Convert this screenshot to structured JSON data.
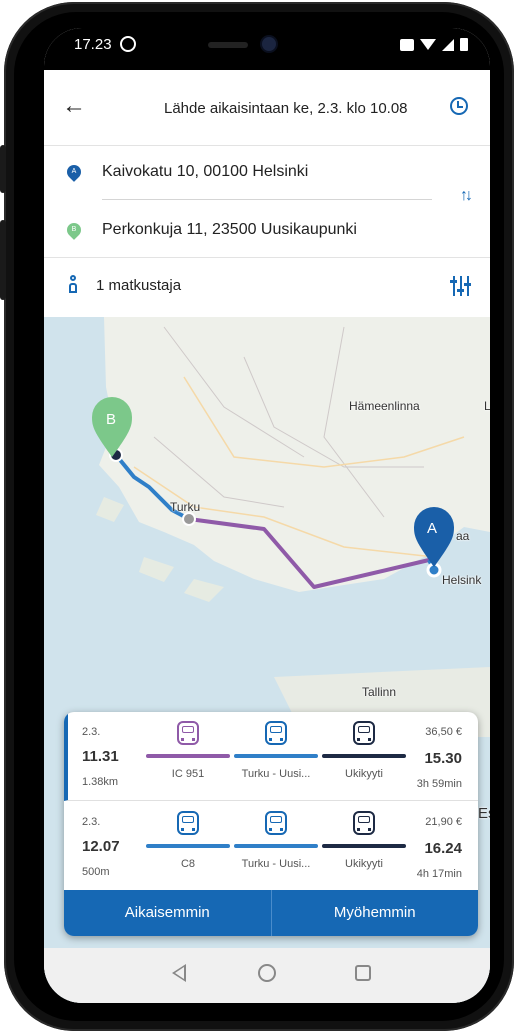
{
  "status": {
    "time": "17.23"
  },
  "header": {
    "departure_text": "Lähde aikaisintaan ke, 2.3. klo 10.08"
  },
  "route": {
    "from": {
      "badge": "A",
      "address": "Kaivokatu 10, 00100 Helsinki"
    },
    "to": {
      "badge": "B",
      "address": "Perkonkuja 11, 23500 Uusikaupunki"
    }
  },
  "passengers": {
    "label": "1 matkustaja"
  },
  "map": {
    "labels": {
      "hameenlinna": "Hämeenlinna",
      "l_edge": "L",
      "turku": "Turku",
      "vantaa": "aa",
      "helsinki": "Helsink",
      "tallinn": "Tallinn",
      "es": "Es"
    },
    "markers": {
      "start": "A",
      "end": "B"
    },
    "colors": {
      "water": "#d0e3ec",
      "land": "#eef0ea",
      "rail_leg": "#8f5aa8",
      "bus_leg": "#2f7fc8"
    }
  },
  "results": [
    {
      "date": "2.3.",
      "depart": "11.31",
      "walk": "1.38km",
      "price": "36,50 €",
      "arrive": "15.30",
      "duration": "3h 59min",
      "legs": [
        {
          "icon": "train-icon",
          "name": "IC 951",
          "color": "#8f5aa8"
        },
        {
          "icon": "bus-icon",
          "name": "Turku - Uusi...",
          "color": "#2f7fc8"
        },
        {
          "icon": "ondemand-bus-icon",
          "name": "Ukikyyti",
          "color": "#1d2a44"
        }
      ]
    },
    {
      "date": "2.3.",
      "depart": "12.07",
      "walk": "500m",
      "price": "21,90 €",
      "arrive": "16.24",
      "duration": "4h 17min",
      "legs": [
        {
          "icon": "bus-icon",
          "name": "C8",
          "color": "#2f7fc8"
        },
        {
          "icon": "bus-icon",
          "name": "Turku - Uusi...",
          "color": "#2f7fc8"
        },
        {
          "icon": "ondemand-bus-icon",
          "name": "Ukikyyti",
          "color": "#1d2a44"
        }
      ]
    }
  ],
  "actions": {
    "earlier": "Aikaisemmin",
    "later": "Myöhemmin"
  },
  "colors": {
    "accent": "#1668b4",
    "marker_a": "#1a5fa8",
    "marker_b": "#7cc88a"
  }
}
